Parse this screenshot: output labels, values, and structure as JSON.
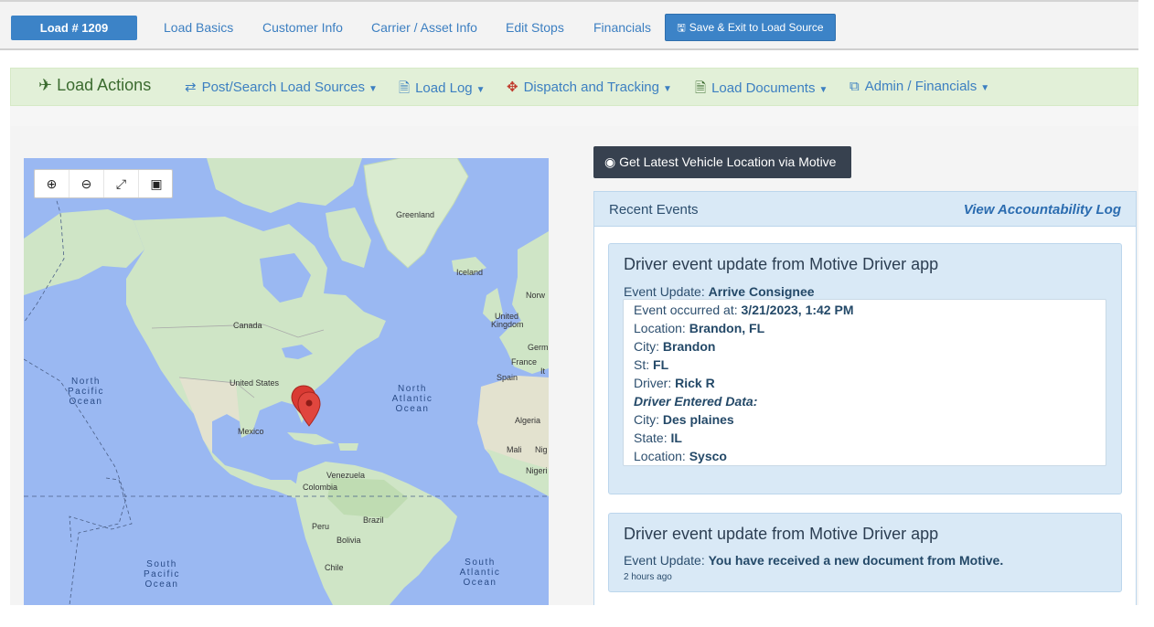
{
  "topbar": {
    "load_badge": "Load # 1209",
    "tabs": [
      "Load Basics",
      "Customer Info",
      "Carrier / Asset Info",
      "Edit Stops",
      "Financials"
    ],
    "save_button": "Save & Exit to Load Source"
  },
  "actions": {
    "title": "Load Actions",
    "items": [
      "Post/Search Load Sources",
      "Load Log",
      "Dispatch and Tracking",
      "Load Documents",
      "Admin / Financials"
    ]
  },
  "map": {
    "labels": {
      "greenland": "Greenland",
      "iceland": "Iceland",
      "canada": "Canada",
      "united_states": "United States",
      "mexico": "Mexico",
      "united_kingdom_1": "United",
      "united_kingdom_2": "Kingdom",
      "norway": "Norw",
      "germany": "Germ",
      "france": "France",
      "italy": "It",
      "spain": "Spain",
      "algeria": "Algeria",
      "mali": "Mali",
      "niger": "Nig",
      "nigeria": "Nigeri",
      "venezuela": "Venezuela",
      "colombia": "Colombia",
      "brazil": "Brazil",
      "peru": "Peru",
      "bolivia": "Bolivia",
      "chile": "Chile"
    },
    "oceans": {
      "north_pacific": [
        "North",
        "Pacific",
        "Ocean"
      ],
      "north_atlantic": [
        "North",
        "Atlantic",
        "Ocean"
      ],
      "south_pacific": [
        "South",
        "Pacific",
        "Ocean"
      ],
      "south_atlantic": [
        "South",
        "Atlantic",
        "Ocean"
      ]
    },
    "colors": {
      "water": "#9ab8f2",
      "land": "#cfe5c6",
      "marker": "#d93a33"
    }
  },
  "tracking": {
    "motive_button": "Get Latest Vehicle Location via Motive"
  },
  "events": {
    "title": "Recent Events",
    "view_log": "View Accountability Log",
    "cards": [
      {
        "heading": "Driver event update from Motive Driver app",
        "update_label": "Event Update:",
        "update_value": "Arrive Consignee",
        "details": {
          "occurred_label": "Event occurred at:",
          "occurred_value": "3/21/2023, 1:42 PM",
          "location_label": "Location:",
          "location_value": "Brandon, FL",
          "city_label": "City:",
          "city_value": "Brandon",
          "st_label": "St:",
          "st_value": "FL",
          "driver_label": "Driver:",
          "driver_value": "Rick R",
          "entered_label": "Driver Entered Data:",
          "entered_city_label": "City:",
          "entered_city_value": "Des plaines",
          "entered_state_label": "State:",
          "entered_state_value": "IL",
          "entered_location_label": "Location:",
          "entered_location_value": "Sysco"
        }
      },
      {
        "heading": "Driver event update from Motive Driver app",
        "update_label": "Event Update:",
        "update_value": "You have received a new document from Motive.",
        "time_ago": "2 hours ago"
      }
    ]
  }
}
